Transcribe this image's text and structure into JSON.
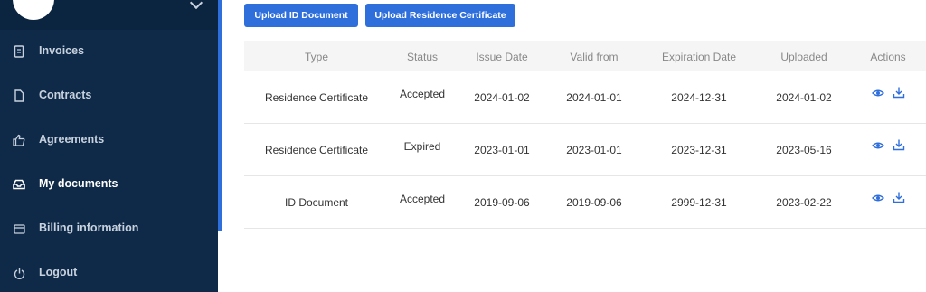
{
  "sidebar": {
    "items": [
      {
        "label": "Invoices",
        "icon": "invoice-icon",
        "active": false
      },
      {
        "label": "Contracts",
        "icon": "document-icon",
        "active": false
      },
      {
        "label": "Agreements",
        "icon": "thumbs-up-icon",
        "active": false
      },
      {
        "label": "My documents",
        "icon": "inbox-icon",
        "active": true
      },
      {
        "label": "Billing information",
        "icon": "credit-card-icon",
        "active": false
      },
      {
        "label": "Logout",
        "icon": "power-icon",
        "active": false
      }
    ]
  },
  "actions": {
    "upload_id": "Upload ID Document",
    "upload_residence": "Upload Residence Certificate"
  },
  "table": {
    "headers": [
      "Type",
      "Status",
      "Issue Date",
      "Valid from",
      "Expiration Date",
      "Uploaded",
      "Actions"
    ],
    "rows": [
      [
        "Residence Certificate",
        "Accepted",
        "2024-01-02",
        "2024-01-01",
        "2024-12-31",
        "2024-01-02"
      ],
      [
        "Residence Certificate",
        "Expired",
        "2023-01-01",
        "2023-01-01",
        "2023-12-31",
        "2023-05-16"
      ],
      [
        "ID Document",
        "Accepted",
        "2019-09-06",
        "2019-09-06",
        "2999-12-31",
        "2023-02-22"
      ]
    ]
  },
  "colors": {
    "sidebar_bg": "#0f2a48",
    "accent": "#2f6fdc",
    "action_icon": "#2f6fdc"
  }
}
